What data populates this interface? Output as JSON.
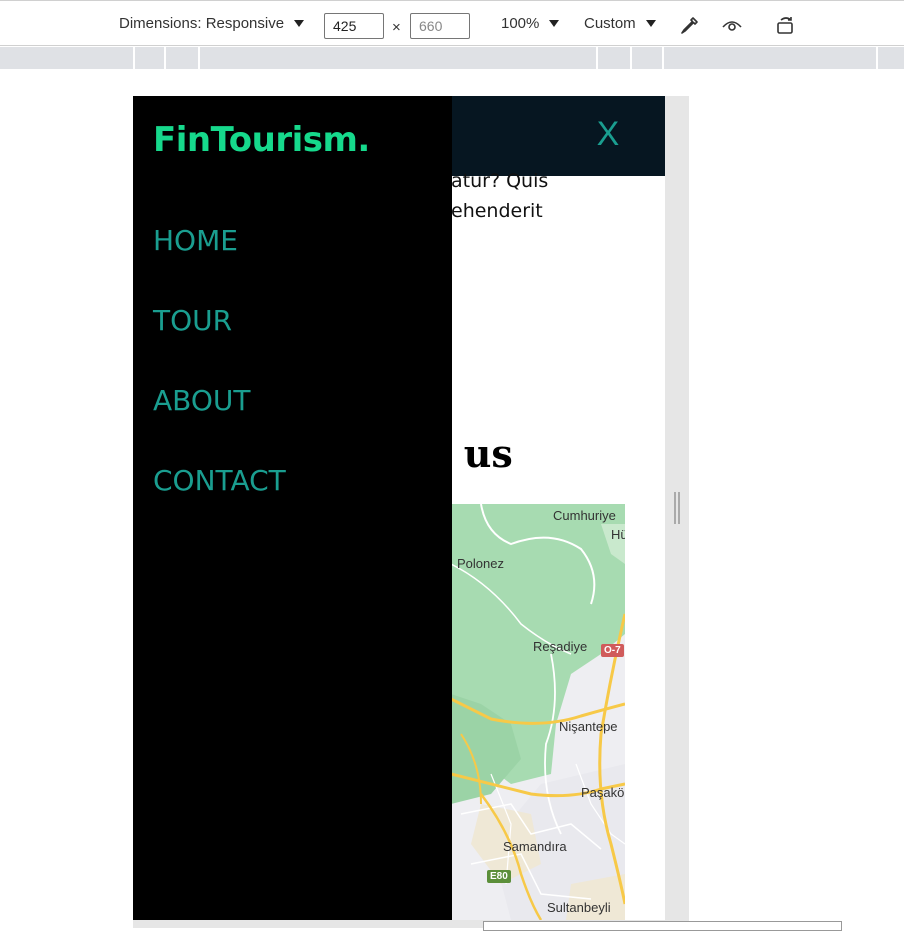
{
  "devtools": {
    "dimensions_label": "Dimensions: Responsive",
    "width_value": "425",
    "height_placeholder": "660",
    "times_sign": "×",
    "zoom": "100%",
    "throttle": "Custom",
    "icons": [
      "eyedropper-icon",
      "eye-icon",
      "rotate-icon"
    ]
  },
  "page": {
    "close_label": "X",
    "body_lines": [
      "atur? Quis",
      "ehenderit"
    ],
    "section_heading": "t us",
    "map_labels": {
      "cumhuriyet": "Cumhuriye",
      "hu": "Hü",
      "polonez": "Polonez",
      "resadiye": "Reşadiye",
      "nisantepe": "Nişantepe",
      "pasakoy": "Paşakö",
      "samandira": "Samandıra",
      "sultanbeyli": "Sultanbeyli",
      "road_o7": "O-7",
      "road_e80": "E80"
    },
    "colors": {
      "header_bg": "#061621",
      "accent": "#1a9e90",
      "brand": "#16d98c"
    }
  },
  "drawer": {
    "brand": "FinTourism.",
    "nav": [
      "HOME",
      "TOUR",
      "ABOUT",
      "CONTACT"
    ]
  }
}
